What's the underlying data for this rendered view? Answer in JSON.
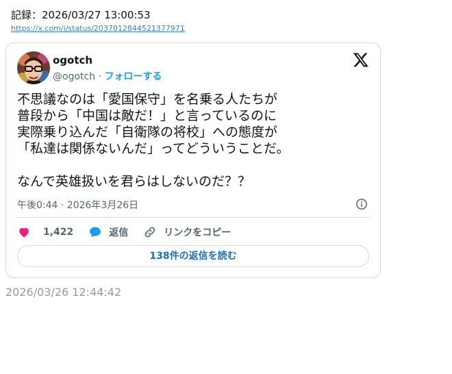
{
  "record": {
    "label": "記録：2026/03/27 13:00:53",
    "url": "https://x.com/i/status/2037012844521377971"
  },
  "tweet": {
    "author_name": "ogotch",
    "handle": "@ogotch",
    "separator": "·",
    "follow_label": "フォローする",
    "text_lines": [
      "不思議なのは「愛国保守」を名乗る人たちが",
      "普段から「中国は敵だ！」と言っているのに",
      "実際乗り込んだ「自衛隊の将校」への態度が",
      "「私達は関係ないんだ」ってどういうことだ。",
      "なんで英雄扱いを君らはしないのだ？？"
    ],
    "timestamp": "午後0:44 · 2026年3月26日",
    "like_count": "1,422",
    "reply_label": "返信",
    "copy_link_label": "リンクをコピー",
    "read_replies_label": "138件の返信を読む"
  },
  "footer": {
    "date": "2026/03/26 12:44:42"
  },
  "colors": {
    "accent": "#1d9bf0",
    "like": "#f91880",
    "muted": "#536471",
    "border": "#cfd9de"
  },
  "icons": [
    "x-logo-icon",
    "info-icon",
    "heart-icon",
    "speech-bubble-icon",
    "link-icon"
  ]
}
